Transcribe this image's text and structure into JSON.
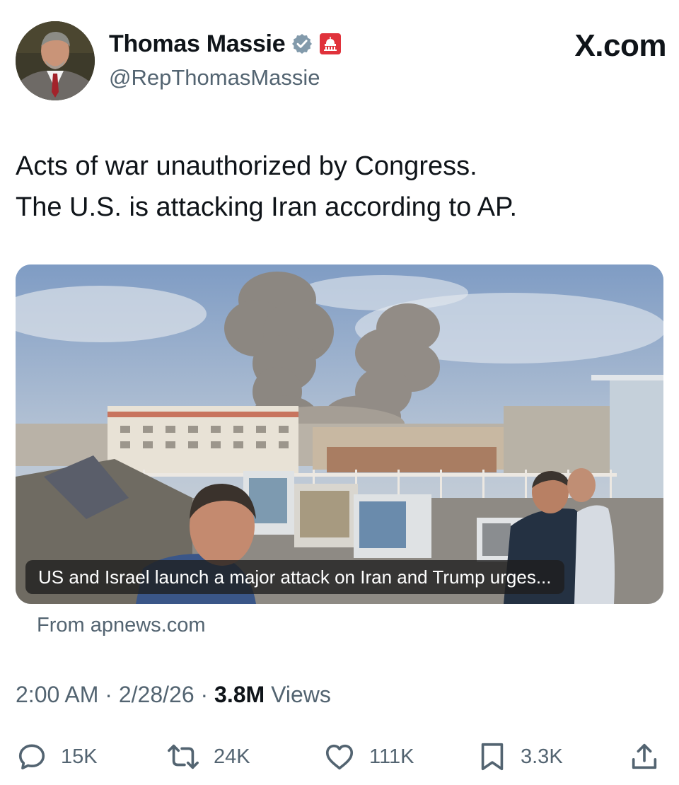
{
  "author": {
    "display_name": "Thomas Massie",
    "handle": "@RepThomasMassie",
    "avatar_icon": "profile-photo",
    "verified_icon": "verified-badge-icon",
    "affiliation_icon": "us-capitol-gov-badge-icon"
  },
  "brand": {
    "label": "X.com"
  },
  "tweet": {
    "lines": [
      "Acts of war unauthorized by Congress.",
      "The U.S. is attacking Iran according to AP."
    ]
  },
  "media": {
    "caption": "US and Israel launch a major attack on Iran and Trump urges...",
    "source": "From apnews.com"
  },
  "meta": {
    "time": "2:00 AM",
    "separator": "·",
    "date": "2/28/26",
    "views_count": "3.8M",
    "views_label": "Views"
  },
  "actions": {
    "replies": {
      "icon": "reply-icon",
      "count": "15K"
    },
    "reposts": {
      "icon": "repost-icon",
      "count": "24K"
    },
    "likes": {
      "icon": "heart-icon",
      "count": "111K"
    },
    "bookmarks": {
      "icon": "bookmark-icon",
      "count": "3.3K"
    },
    "share": {
      "icon": "share-icon"
    }
  },
  "colors": {
    "text_primary": "#0f1419",
    "text_secondary": "#536471",
    "verified_badge": "#829aab",
    "gov_badge": "#e0323b"
  }
}
